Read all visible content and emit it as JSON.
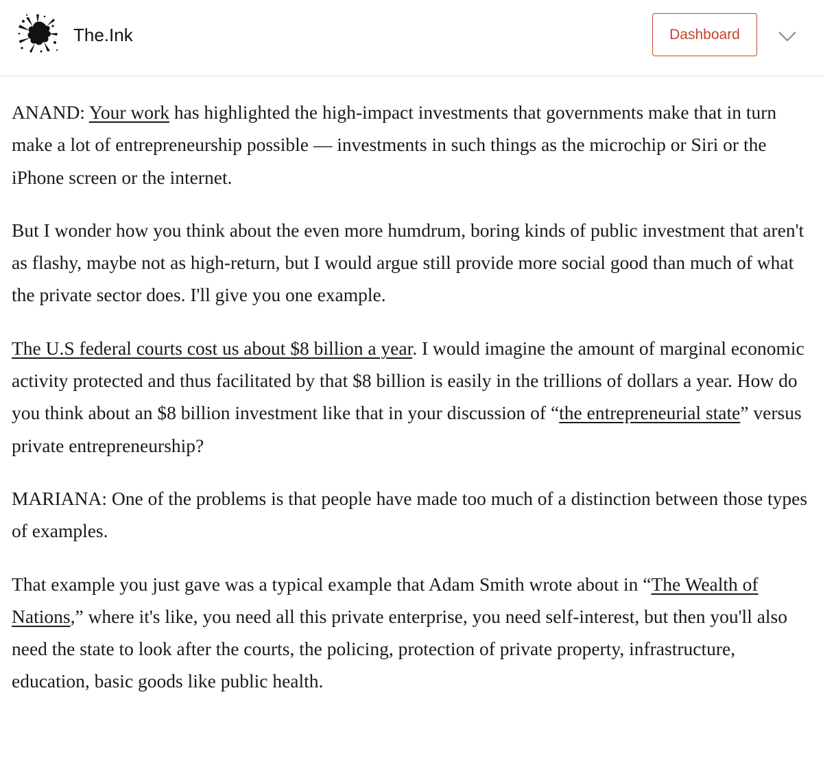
{
  "header": {
    "site_name": "The.Ink",
    "logo_icon": "ink-splatter-icon",
    "dashboard_label": "Dashboard",
    "menu_icon": "chevron-down-icon",
    "accent_color": "#c8442a"
  },
  "article": {
    "p1": {
      "speaker": "ANAND:",
      "link": "Your work",
      "text": "has highlighted the high-impact investments that governments make that in turn make a lot of entrepreneurship possible — investments in such things as the microchip or Siri or the iPhone screen or the internet."
    },
    "p2": {
      "text": "But I wonder how you think about the even more humdrum, boring kinds of public investment that aren't as flashy, maybe not as high-return, but I would argue still provide more social good than much of what the private sector does. I'll give you one example."
    },
    "p3": {
      "link": "The U.S federal courts cost us about $8 billion a year",
      "text_a": ". I would imagine the amount of marginal economic activity protected and thus facilitated by that $8 billion is easily in the trillions of dollars a year. How do you think about an $8 billion investment like that in your discussion of “",
      "link2": "the entrepreneurial state",
      "text_b": "” versus private entrepreneurship?"
    },
    "p4": {
      "text": "MARIANA: One of the problems is that people have made too much of a distinction between those types of examples."
    },
    "p5": {
      "text_a": "That example you just gave was a typical example that Adam Smith wrote about in “",
      "link": "The Wealth of Nations",
      "text_b": ",” where it's like, you need all this private enterprise, you need self-interest, but then you'll also need the state to look after the courts, the policing, protection of private property, infrastructure, education, basic goods like public health."
    }
  }
}
